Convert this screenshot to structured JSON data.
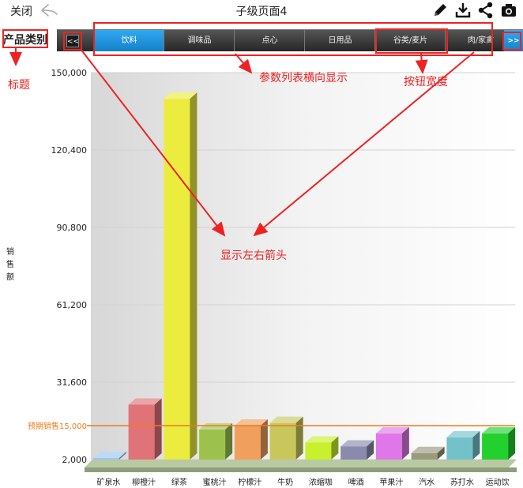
{
  "topbar": {
    "close_label": "关闭",
    "title": "子级页面4"
  },
  "param": {
    "label": "产品类别",
    "prev_label": "<<",
    "next_label": ">>",
    "tabs": [
      "饮料",
      "调味品",
      "点心",
      "日用品",
      "谷类/麦片",
      "肉/家禽"
    ],
    "active_index": 0
  },
  "annotations": {
    "title_note": "标题",
    "list_note": "参数列表横向显示",
    "width_note": "按钮宽度",
    "arrows_note": "显示左右箭头"
  },
  "colors": {
    "accent": "#1e90d8",
    "annotation": "#ee2222",
    "target_line": "#f07a1c"
  },
  "chart_data": {
    "type": "bar",
    "ylabel": "销售额",
    "yticks": [
      2000,
      31600,
      61200,
      90800,
      120400,
      150000
    ],
    "ytick_labels": [
      "2,000",
      "31,600",
      "61,200",
      "90,800",
      "120,400",
      "150,000"
    ],
    "ylim": [
      2000,
      150000
    ],
    "grid": true,
    "categories": [
      "矿泉水",
      "柳橙汁",
      "绿茶",
      "蜜桃汁",
      "柠檬汁",
      "牛奶",
      "浓缩咖",
      "啤酒",
      "苹果汁",
      "汽水",
      "苏打水",
      "运动饮"
    ],
    "values": [
      2500,
      23000,
      140000,
      13500,
      15000,
      16000,
      8500,
      7000,
      12000,
      4500,
      10500,
      12000
    ],
    "colors": [
      "#9cc6f0",
      "#e07377",
      "#ecec3e",
      "#9cc24c",
      "#f0a05c",
      "#c9c75c",
      "#c9f02c",
      "#8a8aac",
      "#e077e8",
      "#9a9a7c",
      "#73c2c9",
      "#22d02e"
    ],
    "target_line": {
      "label": "预期销售15,000",
      "value": 15000
    }
  }
}
